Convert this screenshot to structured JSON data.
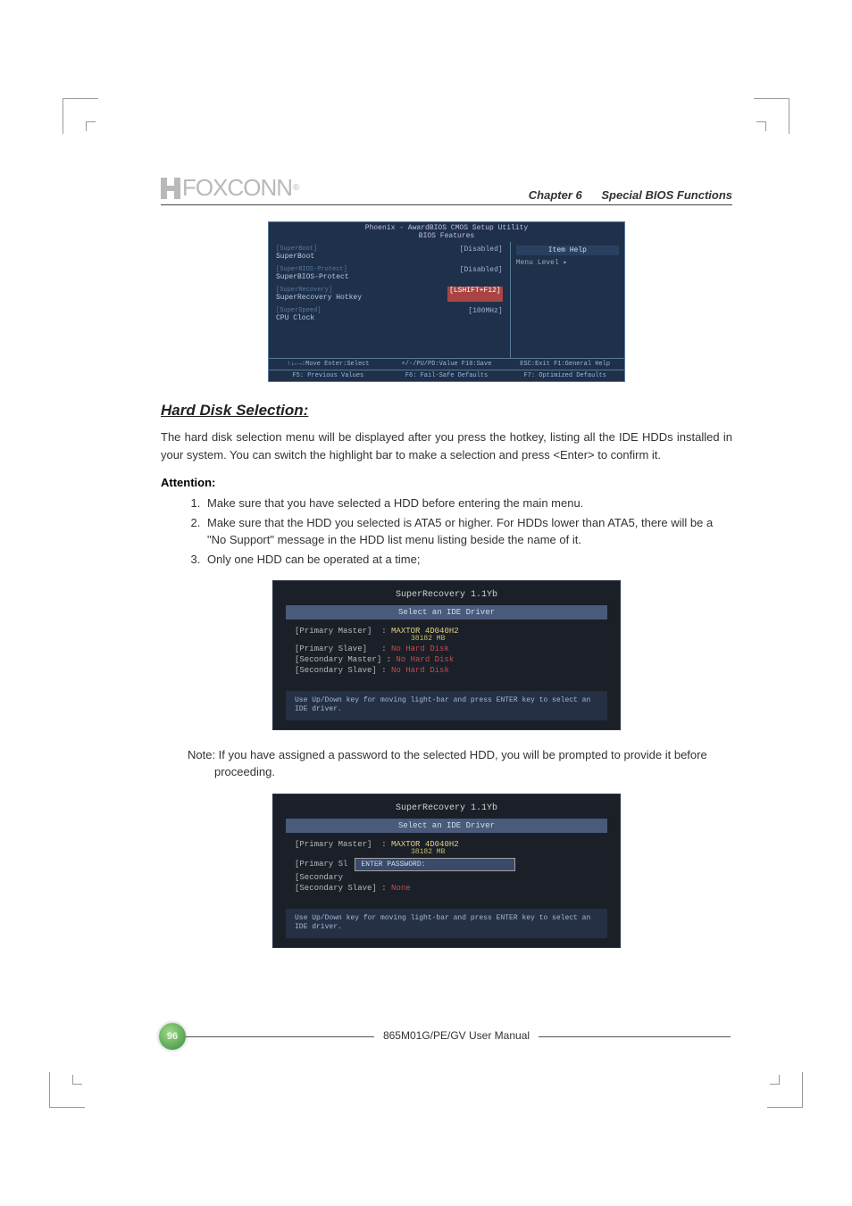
{
  "header": {
    "logo_text": "FOXCONN",
    "chapter": "Chapter 6",
    "chapter_sub": "Special BIOS Functions"
  },
  "bios": {
    "title1": "Phoenix - AwardBIOS CMOS Setup Utility",
    "title2": "BIOS Features",
    "rows": [
      {
        "dim": "[SuperBoot]",
        "main": "SuperBoot",
        "val": "[Disabled]"
      },
      {
        "dim": "[SuperBIOS-Protect]",
        "main": "SuperBIOS-Protect",
        "val": "[Disabled]"
      },
      {
        "dim": "[SuperRecovery]",
        "main": "SuperRecovery Hotkey",
        "val": "[LSHIFT+F12]"
      },
      {
        "dim": "[SuperSpeed]",
        "main": "CPU Clock",
        "val": "[100MHz]"
      }
    ],
    "right_header": "Item Help",
    "right_sub": "Menu Level   ▸",
    "footer": [
      "↑↓←→:Move  Enter:Select",
      "+/-/PU/PD:Value  F10:Save",
      "ESC:Exit  F1:General Help",
      "F5: Previous Values",
      "F6: Fail-Safe Defaults",
      "F7: Optimized Defaults"
    ]
  },
  "section_title": "Hard Disk Selection:",
  "para1": "The hard disk selection menu will be displayed after you press the hotkey, listing all the IDE HDDs installed in your system. You can switch the highlight bar to make a selection and press <Enter> to confirm it.",
  "attention_label": "Attention:",
  "steps": [
    "Make sure that you have selected a HDD before entering the main menu.",
    "Make sure that the HDD you selected is ATA5 or higher. For HDDs lower than ATA5, there will be a \"No Support\" message in the HDD list menu listing beside the name of it.",
    "Only one HDD can be operated at a time;"
  ],
  "sr1": {
    "title": "SuperRecovery 1.1Yb",
    "header": "Select an IDE Driver",
    "rows": [
      {
        "label": "[Primary Master]",
        "value": "MAXTOR 4D040H2",
        "sub": "38182 MB"
      },
      {
        "label": "[Primary Slave]",
        "value": "No Hard Disk"
      },
      {
        "label": "[Secondary Master]",
        "value": "No Hard Disk"
      },
      {
        "label": "[Secondary Slave]",
        "value": "No Hard Disk"
      }
    ],
    "hint": "Use Up/Down key for moving light-bar and press ENTER key to select an IDE driver."
  },
  "note": "Note: If you have assigned a password to the selected HDD, you will be prompted to provide it before proceeding.",
  "sr2": {
    "title": "SuperRecovery 1.1Yb",
    "header": "Select an IDE Driver",
    "rows": [
      {
        "label": "[Primary Master]",
        "value": "MAXTOR 4D040H2",
        "sub": "38182 MB"
      },
      {
        "label": "[Primary Sl",
        "password_prompt": "ENTER PASSWORD:"
      },
      {
        "label": "[Secondary"
      },
      {
        "label": "[Secondary Slave]",
        "value": "None"
      }
    ],
    "hint": "Use Up/Down key for moving light-bar and press ENTER key to select an IDE driver."
  },
  "footer": {
    "page": "96",
    "manual": "865M01G/PE/GV User Manual"
  }
}
